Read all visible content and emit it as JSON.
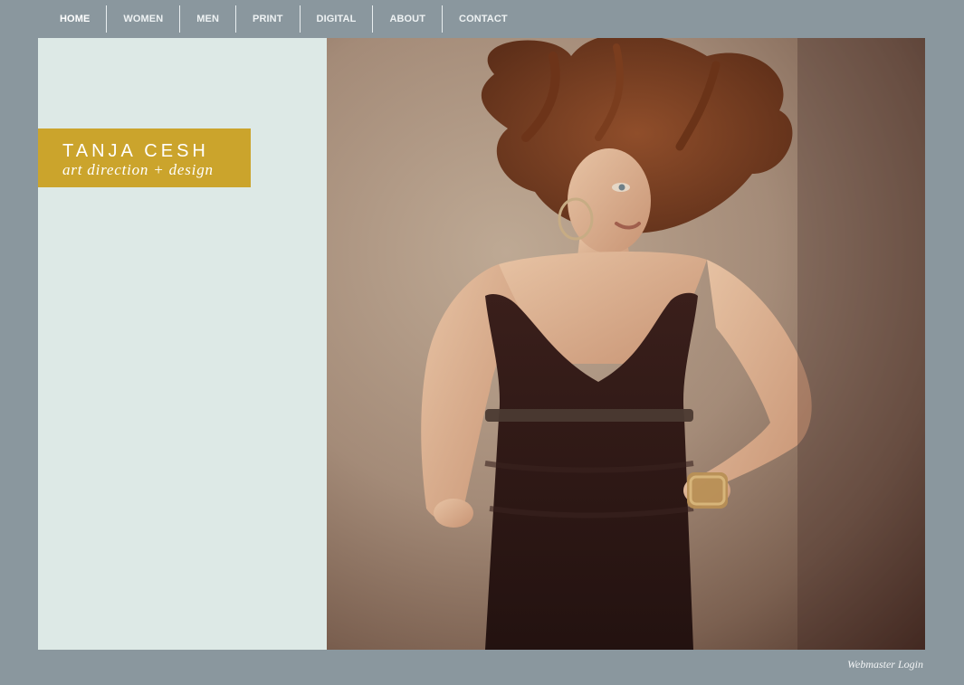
{
  "nav": {
    "items": [
      {
        "label": "HOME",
        "active": true
      },
      {
        "label": "WOMEN"
      },
      {
        "label": "MEN"
      },
      {
        "label": "PRINT"
      },
      {
        "label": "DIGITAL"
      },
      {
        "label": "ABOUT"
      },
      {
        "label": "CONTACT"
      }
    ]
  },
  "brand": {
    "name": "TANJA CESH",
    "tagline": "art direction + design"
  },
  "hero": {
    "image": "fashion-model-photo"
  },
  "footer": {
    "login_label": "Webmaster Login"
  },
  "colors": {
    "background": "#8a979e",
    "panel": "#dde9e6",
    "brand_accent": "#cba42c"
  }
}
